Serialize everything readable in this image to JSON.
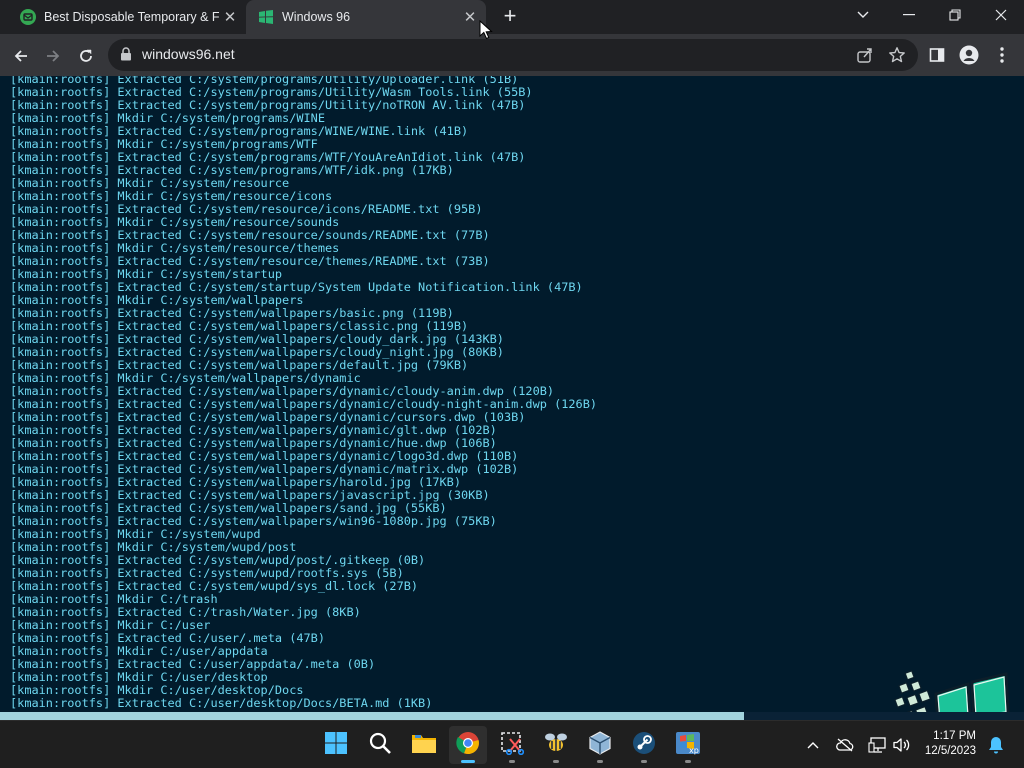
{
  "browser": {
    "tabs": [
      {
        "title": "Best Disposable Temporary & Fa",
        "favicon": "disposable-mail-icon",
        "favicon_color": "#34a853",
        "active": false
      },
      {
        "title": "Windows 96",
        "favicon": "windows96-icon",
        "favicon_color": "#2bb673",
        "active": true
      }
    ],
    "url": "windows96.net",
    "accent": "#8ab4f8"
  },
  "console": {
    "prefix": "[kmain:rootfs]",
    "text_color": "#6ed7f0",
    "background": "#011b2c",
    "lines": [
      "[kmain:rootfs] Extracted C:/system/programs/Utility/Uploader.link (51B)",
      "[kmain:rootfs] Extracted C:/system/programs/Utility/Wasm Tools.link (55B)",
      "[kmain:rootfs] Extracted C:/system/programs/Utility/noTRON AV.link (47B)",
      "[kmain:rootfs] Mkdir C:/system/programs/WINE",
      "[kmain:rootfs] Extracted C:/system/programs/WINE/WINE.link (41B)",
      "[kmain:rootfs] Mkdir C:/system/programs/WTF",
      "[kmain:rootfs] Extracted C:/system/programs/WTF/YouAreAnIdiot.link (47B)",
      "[kmain:rootfs] Extracted C:/system/programs/WTF/idk.png (17KB)",
      "[kmain:rootfs] Mkdir C:/system/resource",
      "[kmain:rootfs] Mkdir C:/system/resource/icons",
      "[kmain:rootfs] Extracted C:/system/resource/icons/README.txt (95B)",
      "[kmain:rootfs] Mkdir C:/system/resource/sounds",
      "[kmain:rootfs] Extracted C:/system/resource/sounds/README.txt (77B)",
      "[kmain:rootfs] Mkdir C:/system/resource/themes",
      "[kmain:rootfs] Extracted C:/system/resource/themes/README.txt (73B)",
      "[kmain:rootfs] Mkdir C:/system/startup",
      "[kmain:rootfs] Extracted C:/system/startup/System Update Notification.link (47B)",
      "[kmain:rootfs] Mkdir C:/system/wallpapers",
      "[kmain:rootfs] Extracted C:/system/wallpapers/basic.png (119B)",
      "[kmain:rootfs] Extracted C:/system/wallpapers/classic.png (119B)",
      "[kmain:rootfs] Extracted C:/system/wallpapers/cloudy_dark.jpg (143KB)",
      "[kmain:rootfs] Extracted C:/system/wallpapers/cloudy_night.jpg (80KB)",
      "[kmain:rootfs] Extracted C:/system/wallpapers/default.jpg (79KB)",
      "[kmain:rootfs] Mkdir C:/system/wallpapers/dynamic",
      "[kmain:rootfs] Extracted C:/system/wallpapers/dynamic/cloudy-anim.dwp (120B)",
      "[kmain:rootfs] Extracted C:/system/wallpapers/dynamic/cloudy-night-anim.dwp (126B)",
      "[kmain:rootfs] Extracted C:/system/wallpapers/dynamic/cursors.dwp (103B)",
      "[kmain:rootfs] Extracted C:/system/wallpapers/dynamic/glt.dwp (102B)",
      "[kmain:rootfs] Extracted C:/system/wallpapers/dynamic/hue.dwp (106B)",
      "[kmain:rootfs] Extracted C:/system/wallpapers/dynamic/logo3d.dwp (110B)",
      "[kmain:rootfs] Extracted C:/system/wallpapers/dynamic/matrix.dwp (102B)",
      "[kmain:rootfs] Extracted C:/system/wallpapers/harold.jpg (17KB)",
      "[kmain:rootfs] Extracted C:/system/wallpapers/javascript.jpg (30KB)",
      "[kmain:rootfs] Extracted C:/system/wallpapers/sand.jpg (55KB)",
      "[kmain:rootfs] Extracted C:/system/wallpapers/win96-1080p.jpg (75KB)",
      "[kmain:rootfs] Mkdir C:/system/wupd",
      "[kmain:rootfs] Mkdir C:/system/wupd/post",
      "[kmain:rootfs] Extracted C:/system/wupd/post/.gitkeep (0B)",
      "[kmain:rootfs] Extracted C:/system/wupd/rootfs.sys (5B)",
      "[kmain:rootfs] Extracted C:/system/wupd/sys_dl.lock (27B)",
      "[kmain:rootfs] Mkdir C:/trash",
      "[kmain:rootfs] Extracted C:/trash/Water.jpg (8KB)",
      "[kmain:rootfs] Mkdir C:/user",
      "[kmain:rootfs] Extracted C:/user/.meta (47B)",
      "[kmain:rootfs] Mkdir C:/user/appdata",
      "[kmain:rootfs] Extracted C:/user/appdata/.meta (0B)",
      "[kmain:rootfs] Mkdir C:/user/desktop",
      "[kmain:rootfs] Mkdir C:/user/desktop/Docs",
      "[kmain:rootfs] Extracted C:/user/desktop/Docs/BETA.md (1KB)"
    ]
  },
  "boot_progress": {
    "value": 0.727,
    "fill_color": "#a1d3dd",
    "track_color": "#0a2236"
  },
  "taskbar": {
    "apps": [
      {
        "name": "start-icon",
        "active": false,
        "running": false
      },
      {
        "name": "search-icon",
        "active": false,
        "running": false
      },
      {
        "name": "file-explorer-icon",
        "active": false,
        "running": false
      },
      {
        "name": "chrome-icon",
        "active": true,
        "running": true
      },
      {
        "name": "snipping-tool-icon",
        "active": false,
        "running": true
      },
      {
        "name": "bee-app-icon",
        "active": false,
        "running": true
      },
      {
        "name": "virtualbox-icon",
        "active": false,
        "running": true
      },
      {
        "name": "steam-icon",
        "active": false,
        "running": true
      },
      {
        "name": "windows-xp-vm-icon",
        "active": false,
        "running": true
      }
    ],
    "clock_time": "1:17 PM",
    "clock_date": "12/5/2023"
  }
}
